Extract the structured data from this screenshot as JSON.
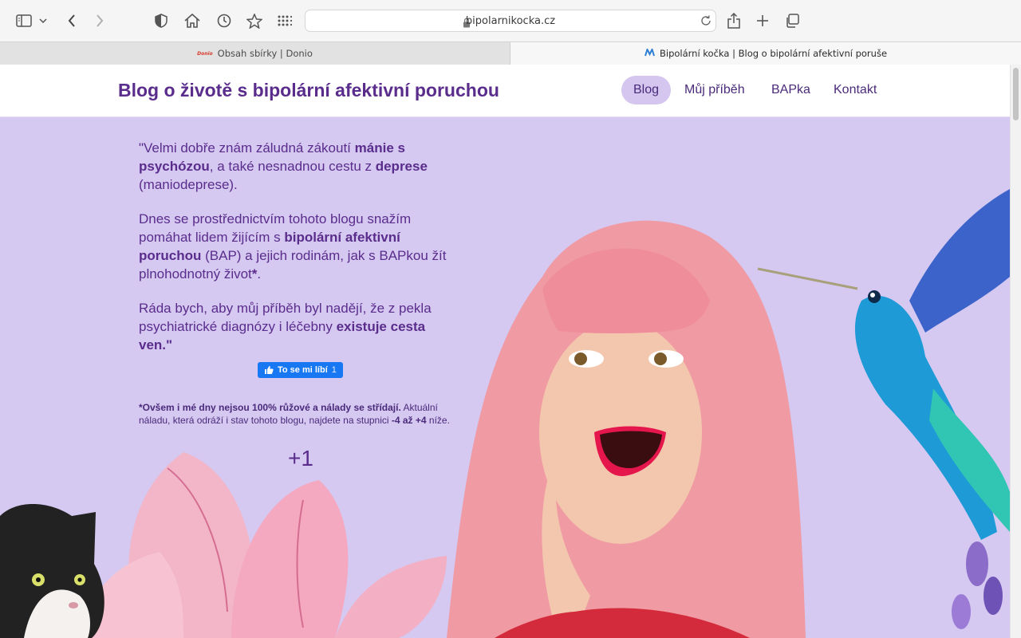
{
  "browser": {
    "url": "bipolarnikocka.cz",
    "tabs": [
      {
        "label": "Obsah sbírky | Donio",
        "favicon": "Donio"
      },
      {
        "label": "Bipolární kočka | Blog o bipolární afektivní poruše",
        "favicon": "bk-logo-icon"
      }
    ],
    "icons": [
      "sidebar-icon",
      "chevron-down-icon",
      "back-icon",
      "forward-icon",
      "shield-icon",
      "home-icon",
      "history-icon",
      "star-icon",
      "grid-icon",
      "lock-icon",
      "reload-icon",
      "share-icon",
      "plus-icon",
      "tabs-icon"
    ]
  },
  "site": {
    "title": "Blog o životě s bipolární afektivní poruchou",
    "nav": [
      {
        "label": "Blog",
        "active": true
      },
      {
        "label": "Můj příběh",
        "active": false
      },
      {
        "label": "BAPka",
        "active": false
      },
      {
        "label": "Kontakt",
        "active": false
      }
    ]
  },
  "hero": {
    "quote": {
      "p1": {
        "a": "\"Velmi dobře znám záludná zákoutí ",
        "b1": "mánie s psychózou",
        "c": ", a také nesnadnou cestu z ",
        "b2": "deprese",
        "d": " (maniodeprese)."
      },
      "p2": {
        "a": "Dnes se prostřednictvím tohoto blogu snažím pomáhat lidem žijícím s ",
        "b1": "bipolární afektivní poruchou",
        "c": " (BAP) a jejich rodinám, jak s BAPkou žít plnohodnotný život",
        "b2": "*",
        "d": "."
      },
      "p3": {
        "a": "Ráda bych, aby můj příběh byl nadějí, že z pekla psychiatrické diagnózy i léčebny ",
        "b1": "existuje cesta ven.",
        "c": "\""
      }
    },
    "like_button": {
      "label": "To se mi líbí",
      "count": "1"
    },
    "note": {
      "b1": "*Ovšem i mé dny nejsou 100% růžové a nálady se střídají.",
      "a": " Aktuální náladu, která odráží i stav tohoto blogu, najdete na stupnici ",
      "b2": "-4 až +4",
      "c": " níže."
    },
    "mood_value": "+1"
  },
  "colors": {
    "brand_purple": "#5a2d8c",
    "hero_background": "#d5c8f1",
    "nav_active_background": "#d4c6ee",
    "facebook_blue": "#1877f2"
  }
}
